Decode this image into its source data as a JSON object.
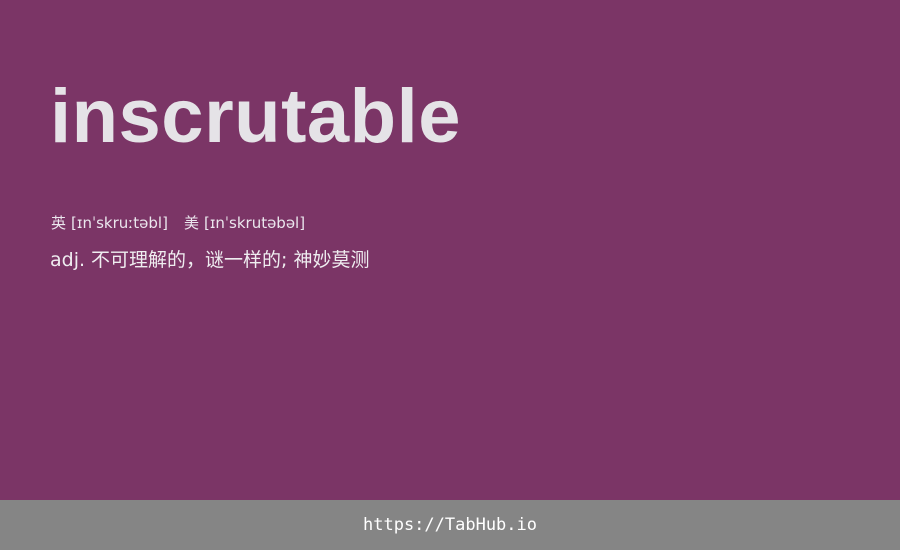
{
  "colors": {
    "background": "#7b3566",
    "footer_background": "#858585",
    "text": "#e5e3e7",
    "footer_text": "#ffffff"
  },
  "entry": {
    "word": "inscrutable",
    "phonetics": {
      "uk": {
        "label": "英",
        "ipa": "[ɪnˈskruːtəbl]"
      },
      "us": {
        "label": "美",
        "ipa": "[ɪnˈskrutəbəl]"
      }
    },
    "definition": {
      "part_of_speech": "adj.",
      "meaning": "不可理解的，谜一样的; 神妙莫测"
    }
  },
  "footer": {
    "link_text": "https://TabHub.io"
  }
}
